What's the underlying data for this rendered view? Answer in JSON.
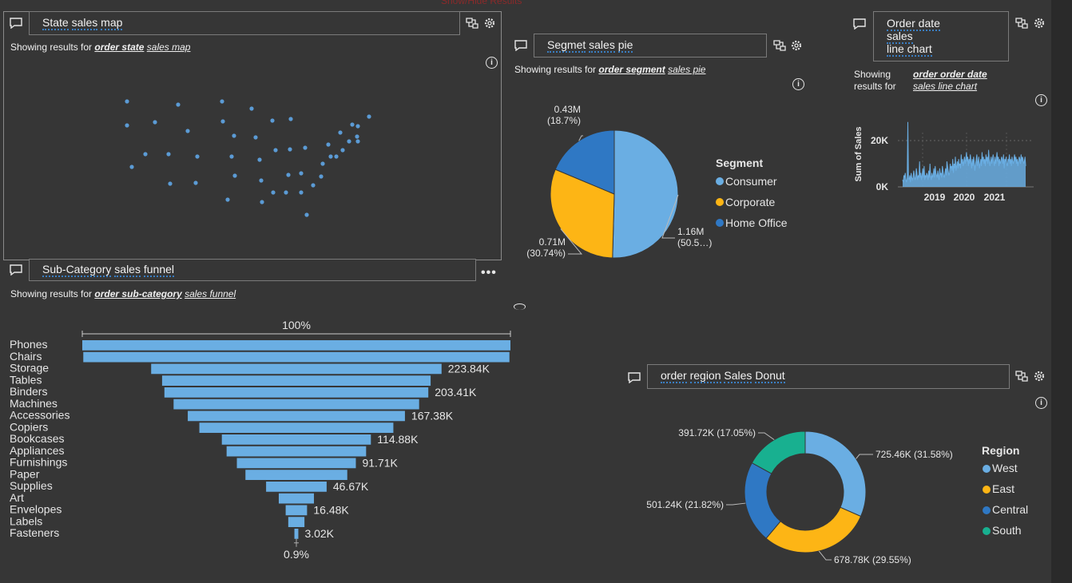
{
  "colors": {
    "background": "#363636",
    "accent_blue": "#6aaee3",
    "dark_blue": "#2f78c4",
    "yellow": "#fdb515",
    "teal": "#18b090"
  },
  "top_partial_text": "Show/Hide Results",
  "map_panel": {
    "query": [
      "State",
      "sales",
      "map"
    ],
    "showing_prefix": "Showing results for",
    "showing_bold": "order state",
    "showing_rest": "sales map"
  },
  "pie_panel": {
    "query": [
      "Segmet",
      "sales",
      "pie"
    ],
    "showing_prefix": "Showing results for",
    "showing_bold": "order segment",
    "showing_rest": "sales pie"
  },
  "line_panel": {
    "query_lines": [
      "Order date",
      "sales",
      "line chart"
    ],
    "showing_prefix_1": "Showing",
    "showing_prefix_2": "results for",
    "showing_bold": "order order date",
    "showing_rest": "sales line chart"
  },
  "funnel_panel": {
    "query": [
      "Sub-Category",
      "sales",
      "funnel"
    ],
    "showing_prefix": "Showing results for",
    "showing_bold": "order sub-category",
    "showing_rest": "sales funnel"
  },
  "donut_panel": {
    "query": [
      "order",
      "region",
      "Sales",
      "Donut"
    ],
    "showing_prefix": "",
    "showing_bold": "",
    "showing_rest": ""
  },
  "chart_data": [
    {
      "type": "scatter",
      "title": "",
      "note": "state sales map points",
      "points": [
        [
          159,
          127
        ],
        [
          223,
          131
        ],
        [
          278,
          127
        ],
        [
          315,
          136
        ],
        [
          159,
          157
        ],
        [
          194,
          153
        ],
        [
          235,
          164
        ],
        [
          279,
          152
        ],
        [
          341,
          151
        ],
        [
          364,
          149
        ],
        [
          293,
          170
        ],
        [
          320,
          172
        ],
        [
          182,
          193
        ],
        [
          211,
          193
        ],
        [
          247,
          196
        ],
        [
          290,
          196
        ],
        [
          325,
          200
        ],
        [
          345,
          188
        ],
        [
          363,
          187
        ],
        [
          382,
          185
        ],
        [
          165,
          209
        ],
        [
          213,
          230
        ],
        [
          245,
          229
        ],
        [
          294,
          220
        ],
        [
          327,
          226
        ],
        [
          361,
          219
        ],
        [
          377,
          217
        ],
        [
          402,
          221
        ],
        [
          285,
          250
        ],
        [
          328,
          253
        ],
        [
          342,
          241
        ],
        [
          358,
          241
        ],
        [
          377,
          241
        ],
        [
          392,
          232
        ],
        [
          411,
          181
        ],
        [
          426,
          166
        ],
        [
          441,
          156
        ],
        [
          448,
          158
        ],
        [
          462,
          146
        ],
        [
          437,
          177
        ],
        [
          447,
          171
        ],
        [
          448,
          177
        ],
        [
          429,
          188
        ],
        [
          421,
          196
        ],
        [
          414,
          196
        ],
        [
          404,
          205
        ],
        [
          384,
          269
        ]
      ]
    },
    {
      "type": "pie",
      "title": "",
      "legend_title": "Segment",
      "slices": [
        {
          "label": "Consumer",
          "value": 1.16,
          "value_text": "1.16M",
          "pct_text": "(50.5…)",
          "color": "#6aaee3"
        },
        {
          "label": "Corporate",
          "value": 0.71,
          "value_text": "0.71M",
          "pct_text": "(30.74%)",
          "color": "#fdb515"
        },
        {
          "label": "Home Office",
          "value": 0.43,
          "value_text": "0.43M",
          "pct_text": "(18.7%)",
          "color": "#2f78c4"
        }
      ]
    },
    {
      "type": "line",
      "title": "",
      "ylabel": "Sum of Sales",
      "yticks": [
        "20K",
        "0K"
      ],
      "xticks": [
        "2019",
        "2020",
        "2021"
      ],
      "values": [
        3,
        2,
        5,
        4,
        6,
        3,
        2,
        4,
        28,
        4,
        3,
        5,
        2,
        6,
        4,
        3,
        4,
        7,
        5,
        3,
        4,
        8,
        6,
        3,
        5,
        4,
        11,
        4,
        6,
        3,
        5,
        8,
        4,
        9,
        3,
        5,
        4,
        6,
        5,
        3,
        7,
        4,
        10,
        5,
        3,
        6,
        4,
        5,
        8,
        4,
        9,
        6,
        5,
        4,
        7,
        5,
        3,
        8,
        5,
        6,
        4,
        9,
        7,
        5,
        4,
        6,
        8,
        5,
        11,
        9,
        7,
        5,
        6,
        10,
        8,
        9,
        7,
        12,
        6,
        10,
        8,
        13,
        7,
        9,
        11,
        8,
        12,
        9,
        10,
        8,
        14,
        10,
        12,
        9,
        11,
        13,
        10,
        12,
        15,
        11,
        13,
        9,
        12,
        10,
        14,
        11,
        8,
        12,
        9,
        13,
        11,
        7,
        10,
        12,
        14,
        9,
        11,
        13,
        8,
        10,
        12,
        9,
        15,
        11,
        13,
        10,
        12,
        9,
        14,
        11,
        13,
        10,
        16,
        12,
        9,
        11,
        13,
        10,
        12,
        14,
        11,
        9,
        13,
        10,
        12,
        15,
        11,
        13,
        9,
        12,
        10,
        11,
        13,
        12,
        10,
        14,
        8,
        12,
        11,
        13,
        10,
        9,
        12,
        11,
        14,
        10,
        12,
        9,
        13,
        11,
        10,
        12,
        14,
        11,
        13,
        10,
        12,
        9,
        11,
        13,
        12,
        10,
        14,
        11,
        13,
        12,
        10,
        11,
        13,
        9
      ]
    },
    {
      "type": "bar",
      "title": "",
      "subtype": "funnel",
      "top_label": "100%",
      "bottom_label": "0.9%",
      "categories": [
        "Phones",
        "Chairs",
        "Storage",
        "Tables",
        "Binders",
        "Machines",
        "Accessories",
        "Copiers",
        "Bookcases",
        "Appliances",
        "Furnishings",
        "Paper",
        "Supplies",
        "Art",
        "Envelopes",
        "Labels",
        "Fasteners"
      ],
      "values": [
        330.01,
        328.45,
        223.84,
        206.97,
        203.41,
        189.24,
        167.38,
        149.53,
        114.88,
        107.53,
        91.71,
        78.48,
        46.67,
        27.12,
        16.48,
        12.49,
        3.02
      ],
      "value_labels": [
        "",
        "",
        "223.84K",
        "",
        "203.41K",
        "",
        "167.38K",
        "",
        "114.88K",
        "",
        "91.71K",
        "",
        "46.67K",
        "",
        "16.48K",
        "",
        "3.02K"
      ]
    },
    {
      "type": "pie",
      "subtype": "donut",
      "title": "",
      "legend_title": "Region",
      "slices": [
        {
          "label": "West",
          "value": 725.46,
          "text": "725.46K (31.58%)",
          "color": "#6aaee3"
        },
        {
          "label": "East",
          "value": 678.78,
          "text": "678.78K (29.55%)",
          "color": "#fdb515"
        },
        {
          "label": "Central",
          "value": 501.24,
          "text": "501.24K (21.82%)",
          "color": "#2f78c4"
        },
        {
          "label": "South",
          "value": 391.72,
          "text": "391.72K (17.05%)",
          "color": "#18b090"
        }
      ]
    }
  ]
}
